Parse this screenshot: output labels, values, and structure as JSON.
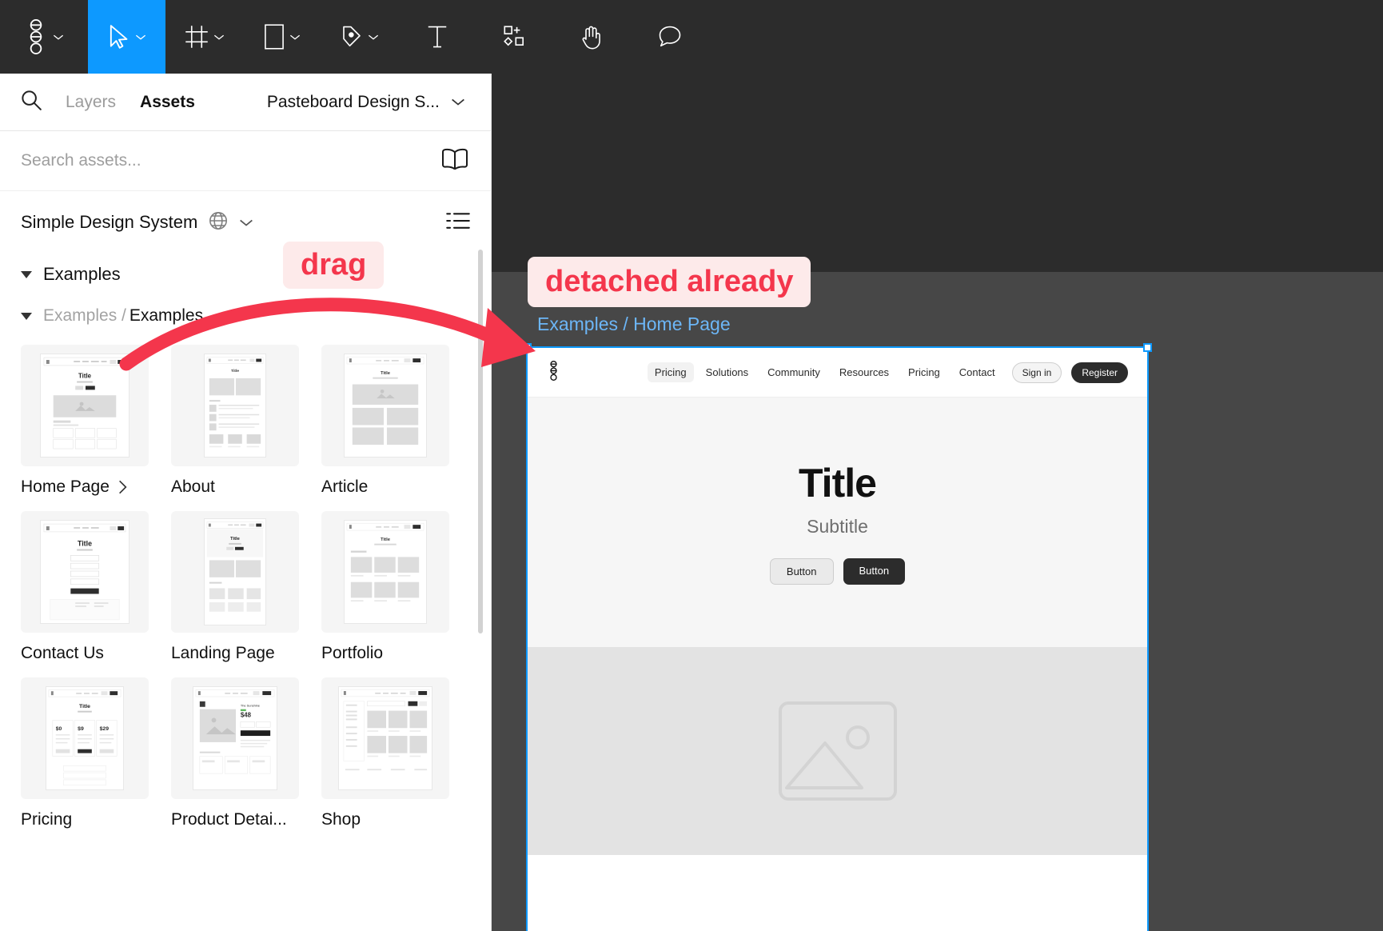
{
  "toolbar": {
    "items": [
      {
        "name": "figma-menu",
        "icon": "figma-logo-icon",
        "chevron": true,
        "active": false
      },
      {
        "name": "move-tool",
        "icon": "cursor-arrow-icon",
        "chevron": true,
        "active": true
      },
      {
        "name": "frame-tool",
        "icon": "frame-icon",
        "chevron": true,
        "active": false
      },
      {
        "name": "shape-tool",
        "icon": "rectangle-icon",
        "chevron": true,
        "active": false
      },
      {
        "name": "pen-tool",
        "icon": "pen-icon",
        "chevron": true,
        "active": false
      },
      {
        "name": "text-tool",
        "icon": "text-icon",
        "chevron": false,
        "active": false
      },
      {
        "name": "resources-tool",
        "icon": "components-plus-icon",
        "chevron": false,
        "active": false
      },
      {
        "name": "hand-tool",
        "icon": "hand-icon",
        "chevron": false,
        "active": false
      },
      {
        "name": "comment-tool",
        "icon": "comment-bubble-icon",
        "chevron": false,
        "active": false
      }
    ]
  },
  "panel": {
    "tabs": [
      {
        "label": "Layers",
        "active": false
      },
      {
        "label": "Assets",
        "active": true
      }
    ],
    "library_selector": "Pasteboard Design S...",
    "search": {
      "placeholder": "Search assets...",
      "value": "",
      "icon": "search-icon",
      "book_icon": "library-book-icon"
    },
    "library": {
      "name": "Simple Design System",
      "globe_icon": "globe-icon",
      "chevron_icon": "chevron-down-icon",
      "list_view_icon": "list-view-icon"
    },
    "groups": [
      {
        "label": "Examples",
        "expanded": true
      },
      {
        "label_muted": "Examples / ",
        "label": "Examples",
        "expanded": true
      }
    ],
    "assets": [
      {
        "label": "Home Page",
        "has_variants": true,
        "thumb": "home"
      },
      {
        "label": "About",
        "has_variants": false,
        "thumb": "about"
      },
      {
        "label": "Article",
        "has_variants": false,
        "thumb": "article"
      },
      {
        "label": "Contact Us",
        "has_variants": false,
        "thumb": "contact"
      },
      {
        "label": "Landing Page",
        "has_variants": false,
        "thumb": "landing"
      },
      {
        "label": "Portfolio",
        "has_variants": false,
        "thumb": "portfolio"
      },
      {
        "label": "Pricing",
        "has_variants": false,
        "thumb": "pricing"
      },
      {
        "label": "Product Detai...",
        "has_variants": false,
        "thumb": "product"
      },
      {
        "label": "Shop",
        "has_variants": false,
        "thumb": "shop"
      }
    ]
  },
  "canvas": {
    "frame_label": "Examples / Home Page",
    "code_icon": "</>",
    "selection_color": "#0d99ff",
    "frame": {
      "navbar": {
        "logo_icon": "figma-logo-icon",
        "links": [
          {
            "label": "Pricing",
            "highlighted": true
          },
          {
            "label": "Solutions",
            "highlighted": false
          },
          {
            "label": "Community",
            "highlighted": false
          },
          {
            "label": "Resources",
            "highlighted": false
          },
          {
            "label": "Pricing",
            "highlighted": false
          },
          {
            "label": "Contact",
            "highlighted": false
          }
        ],
        "sign_in": "Sign in",
        "register": "Register"
      },
      "hero": {
        "title": "Title",
        "subtitle": "Subtitle",
        "button_secondary": "Button",
        "button_primary": "Button"
      },
      "media_icon": "image-placeholder-icon"
    }
  },
  "annotations": {
    "drag": "drag",
    "detached": "detached already",
    "arrow_color": "#f4364c"
  }
}
